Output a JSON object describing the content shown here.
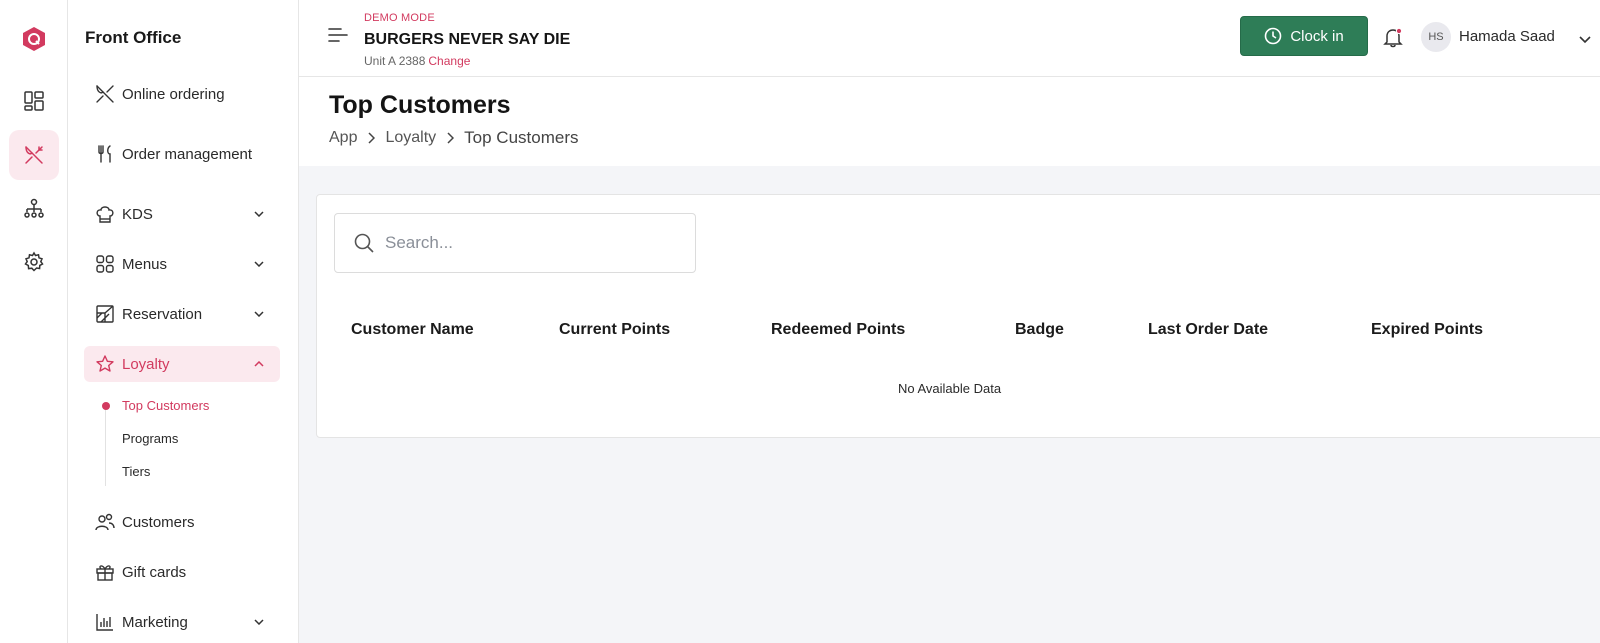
{
  "sidebar": {
    "title": "Front Office",
    "items": [
      {
        "label": "Online ordering"
      },
      {
        "label": "Order management"
      },
      {
        "label": "KDS"
      },
      {
        "label": "Menus"
      },
      {
        "label": "Reservation"
      },
      {
        "label": "Loyalty"
      },
      {
        "label": "Customers"
      },
      {
        "label": "Gift cards"
      },
      {
        "label": "Marketing"
      }
    ],
    "loyalty_sub": [
      {
        "label": "Top Customers"
      },
      {
        "label": "Programs"
      },
      {
        "label": "Tiers"
      }
    ]
  },
  "header": {
    "demo_mode": "DEMO MODE",
    "brand": "BURGERS NEVER SAY DIE",
    "unit": "Unit A 2388",
    "change": "Change",
    "clock_in": "Clock in",
    "avatar_initials": "HS",
    "user_name": "Hamada Saad"
  },
  "page": {
    "title": "Top Customers",
    "breadcrumbs": [
      "App",
      "Loyalty",
      "Top Customers"
    ]
  },
  "search": {
    "placeholder": "Search..."
  },
  "table": {
    "columns": [
      "Customer Name",
      "Current Points",
      "Redeemed Points",
      "Badge",
      "Last Order Date",
      "Expired Points"
    ],
    "empty_text": "No Available Data"
  },
  "colors": {
    "accent": "#d23a5f",
    "clock_button": "#2e7d57",
    "active_bg": "#fbe9ee"
  }
}
